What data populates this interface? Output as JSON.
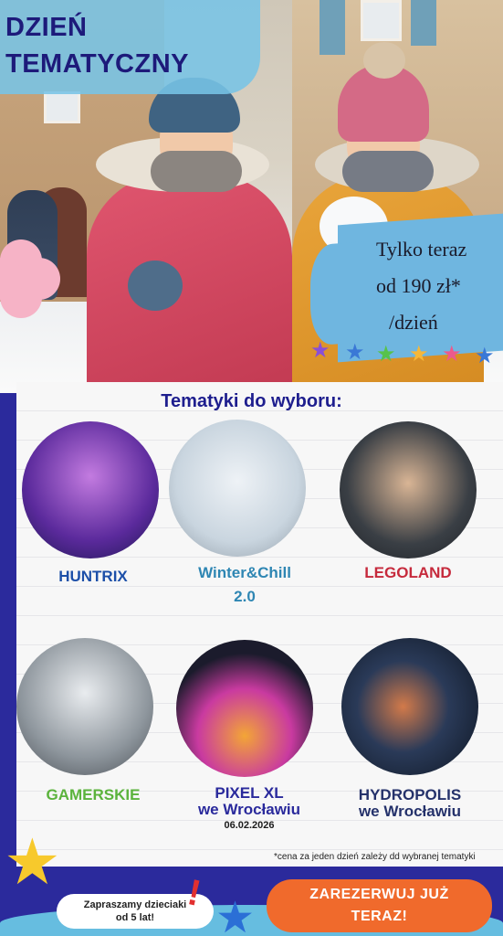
{
  "header": {
    "title_line1": "DZIEŃ",
    "title_line2": "TEMATYCZNY"
  },
  "promo": {
    "line1": "Tylko teraz",
    "line2": "od 190 zł*",
    "line3": "/dzień"
  },
  "section_title": "Tematyki do wyboru:",
  "themes": [
    {
      "label": "HUNTRIX",
      "sub": "",
      "color": "#1c4fa8"
    },
    {
      "label_line1": "Winter&Chill",
      "label_line2": "2.0",
      "color": "#2e86b3"
    },
    {
      "label": "LEGOLAND",
      "color": "#c62a3c"
    },
    {
      "label": "GAMERSKIE",
      "color": "#5bb33c"
    },
    {
      "label_line1": "PIXEL XL",
      "label_line2": "we Wrocławiu",
      "date": "06.02.2026",
      "color": "#2a2a9c"
    },
    {
      "label_line1": "HYDROPOLIS",
      "label_line2": "we Wrocławiu",
      "color": "#25326b"
    }
  ],
  "footnote": "*cena za jeden dzień zależy dd wybranej tematyki",
  "invite": {
    "line1": "Zapraszamy dzieciaki",
    "line2": "od 5 lat!"
  },
  "cta": {
    "line1": "ZAREZERWUJ JUŻ",
    "line2": "TERAZ!"
  },
  "colors": {
    "navy": "#2b2a9c",
    "sky": "#6fb6e0",
    "orange": "#f06a2c"
  }
}
